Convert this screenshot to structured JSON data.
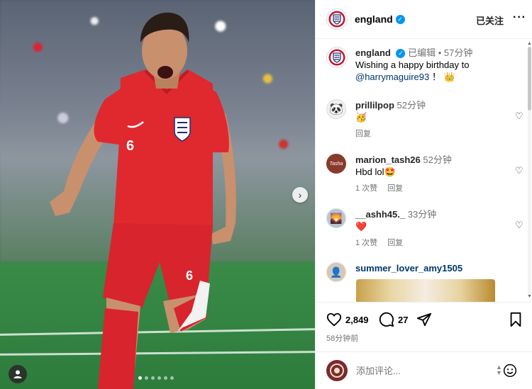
{
  "post": {
    "carousel": {
      "next_icon": "chevron-right-icon",
      "tag_icon": "user-tag-icon",
      "dot_count": 6,
      "active_dot": 0
    }
  },
  "header": {
    "username": "england",
    "follow_status": "已关注",
    "more_icon": "more-horizontal-icon"
  },
  "caption": {
    "username": "england",
    "edited": "已编辑",
    "separator": "•",
    "time": "57分钟",
    "text": "Wishing a happy birthday to",
    "mention": "@harrymaguire93",
    "suffix": "！"
  },
  "comments": [
    {
      "username": "prillilpop",
      "time": "52分钟",
      "text": "🥳",
      "likes": "",
      "reply_label": "回复"
    },
    {
      "username": "marion_tash26",
      "time": "52分钟",
      "text": "Hbd lol🤩",
      "likes": "1 次赞",
      "reply_label": "回复"
    },
    {
      "username": "__ashh45._",
      "time": "33分钟",
      "text": "❤️",
      "likes": "1 次赞",
      "reply_label": "回复"
    },
    {
      "username": "summer_lover_amy1505",
      "time": "",
      "text": "",
      "likes": "",
      "reply_label": ""
    }
  ],
  "stats": {
    "likes": "2,849",
    "comments": "27",
    "posted": "58分钟前"
  },
  "add_comment": {
    "placeholder": "添加评论..."
  },
  "colors": {
    "verified": "#0095f6",
    "link": "#00376b",
    "kit_red": "#e0282f",
    "heart_red": "#ed4956"
  }
}
